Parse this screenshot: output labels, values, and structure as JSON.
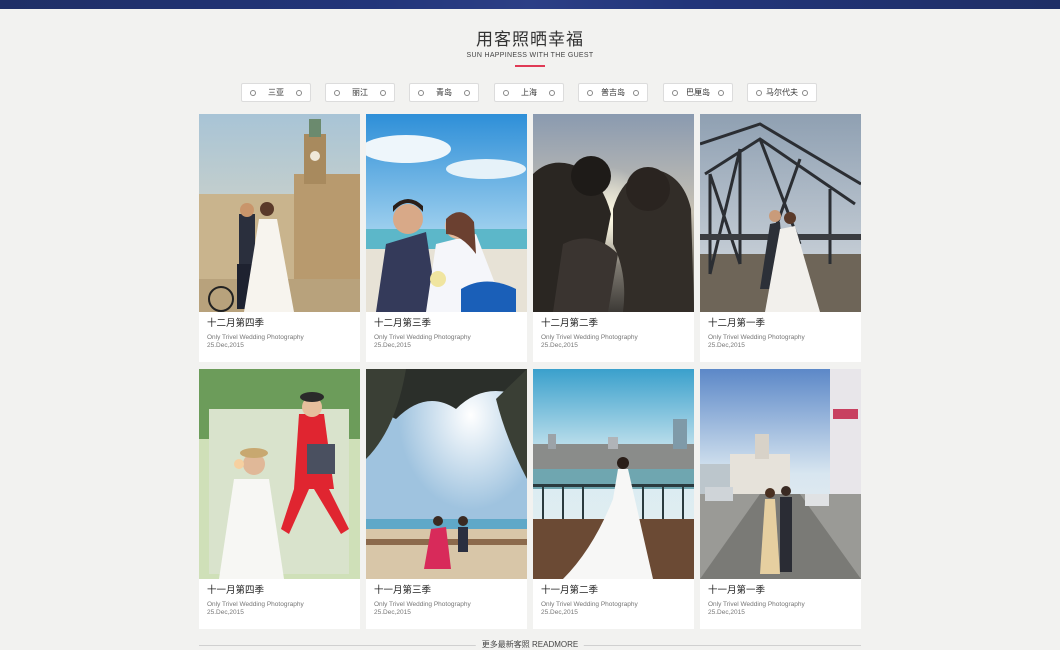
{
  "header": {
    "title": "用客照晒幸福",
    "subtitle": "SUN HAPPINESS WITH THE GUEST",
    "accent_color": "#e03a55",
    "topbar_color": "#22357a"
  },
  "tabs": [
    {
      "label": "三亚"
    },
    {
      "label": "丽江"
    },
    {
      "label": "青岛"
    },
    {
      "label": "上海"
    },
    {
      "label": "普吉岛"
    },
    {
      "label": "巴厘岛"
    },
    {
      "label": "马尔代夫"
    }
  ],
  "cards": [
    {
      "title": "十二月第四季",
      "subtitle": "Only Trivel Wedding Photography",
      "date": "25.Dec,2015"
    },
    {
      "title": "十二月第三季",
      "subtitle": "Only Trivel Wedding Photography",
      "date": "25.Dec,2015"
    },
    {
      "title": "十二月第二季",
      "subtitle": "Only Trivel Wedding Photography",
      "date": "25.Dec,2015"
    },
    {
      "title": "十二月第一季",
      "subtitle": "Only Trivel Wedding Photography",
      "date": "25.Dec,2015"
    },
    {
      "title": "十一月第四季",
      "subtitle": "Only Trivel Wedding Photography",
      "date": "25.Dec,2015"
    },
    {
      "title": "十一月第三季",
      "subtitle": "Only Trivel Wedding Photography",
      "date": "25.Dec,2015"
    },
    {
      "title": "十一月第二季",
      "subtitle": "Only Trivel Wedding Photography",
      "date": "25.Dec,2015"
    },
    {
      "title": "十一月第一季",
      "subtitle": "Only Trivel Wedding Photography",
      "date": "25.Dec,2015"
    }
  ],
  "footer": {
    "more_label": "更多最新客照 READMORE"
  }
}
